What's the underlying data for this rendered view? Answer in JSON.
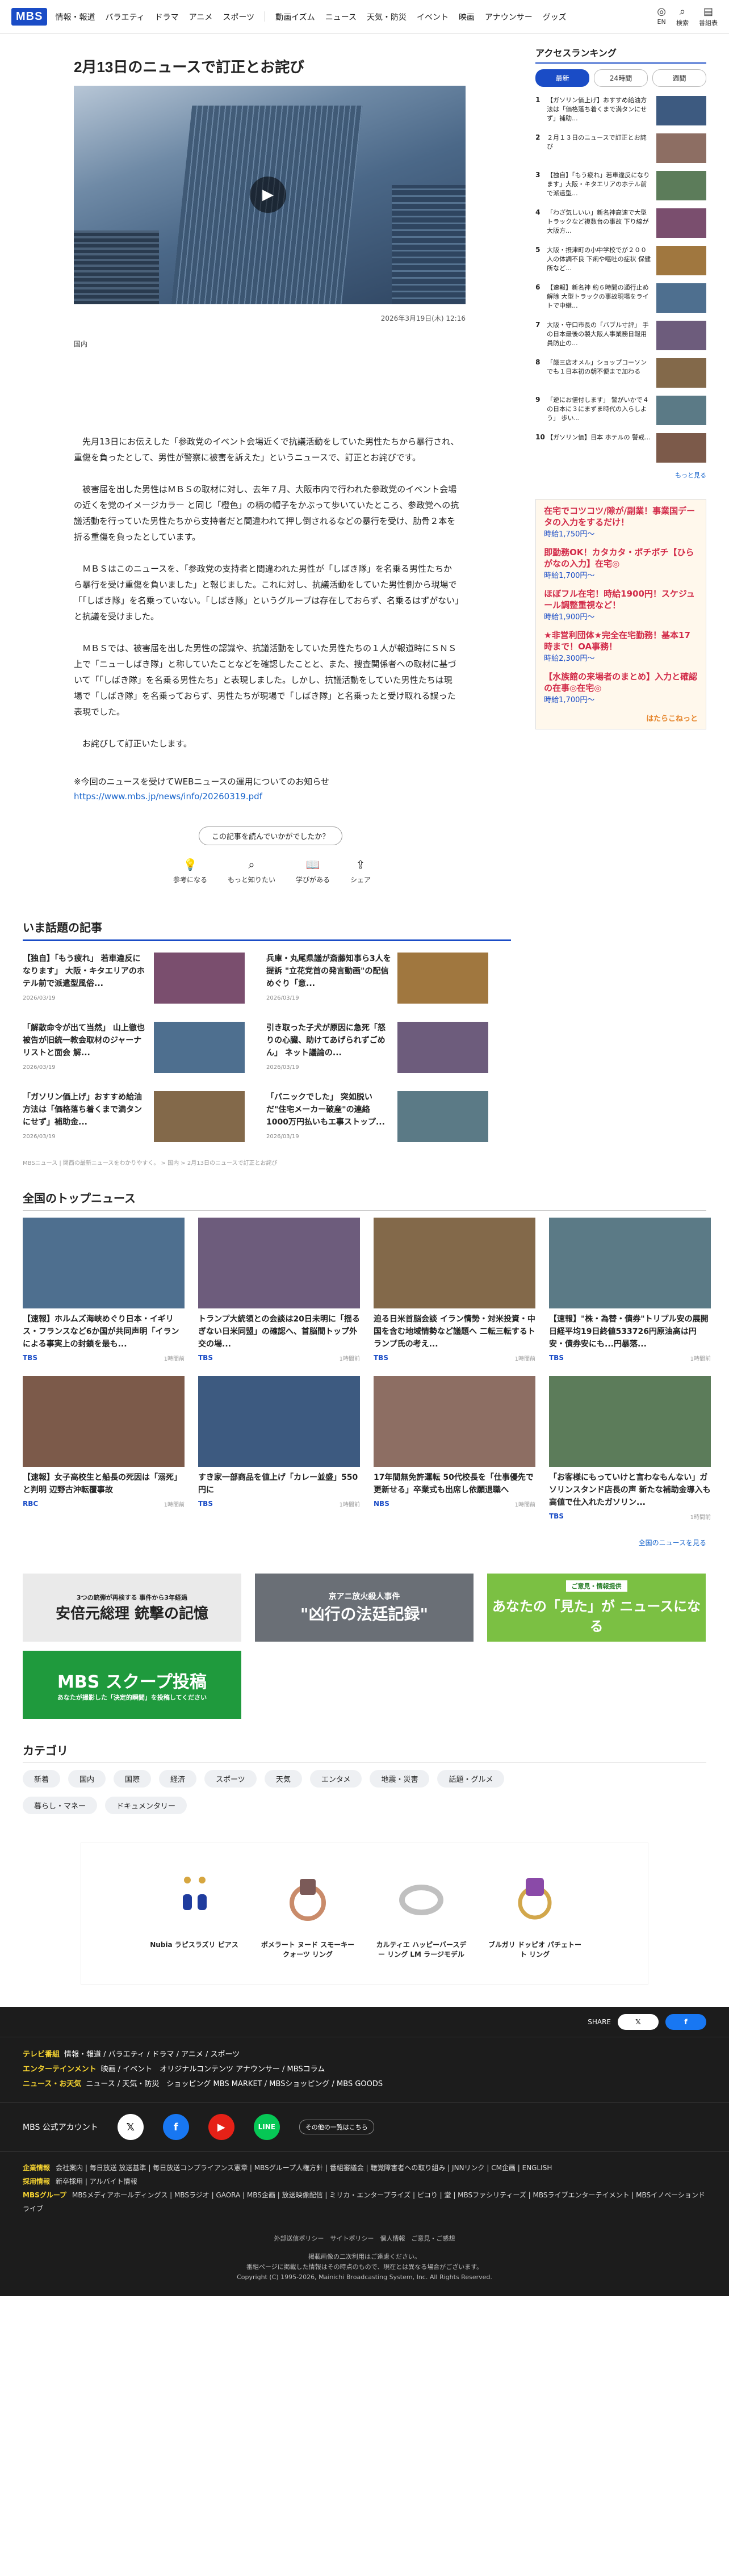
{
  "header": {
    "logo": "MBS",
    "nav": [
      "情報・報道",
      "バラエティ",
      "ドラマ",
      "アニメ",
      "スポーツ",
      "動画イズム",
      "ニュース",
      "天気・防災",
      "イベント",
      "映画",
      "アナウンサー",
      "グッズ"
    ],
    "icons": [
      {
        "label": "EN",
        "icon": "globe-icon"
      },
      {
        "label": "検索",
        "icon": "search-icon"
      },
      {
        "label": "番組表",
        "icon": "tv-guide-icon"
      }
    ]
  },
  "article": {
    "title": "2月13日のニュースで訂正とお詫び",
    "date": "2026年3月19日(木) 12:16",
    "category": "国内",
    "paragraphs": [
      "先月13日にお伝えした「参政党のイベント会場近くで抗議活動をしていた男性たちから暴行され、重傷を負ったとして、男性が警察に被害を訴えた」というニュースで、訂正とお詫びです。",
      "被害届を出した男性はＭＢＳの取材に対し、去年７月、大阪市内で行われた参政党のイベント会場の近くを党のイメージカラー と同じ「橙色」の柄の帽子をかぶって歩いていたところ、参政党への抗議活動を行っていた男性たちから支持者だと間違われて押し倒されるなどの暴行を受け、肋骨２本を折る重傷を負ったとしています。",
      "ＭＢＳはこのニュースを、「参政党の支持者と間違われた男性が「しばき隊」を名乗る男性たちから暴行を受け重傷を負いました」と報じました。これに対し、抗議活動をしていた男性側から現場で「「しばき隊」を名乗っていない。「しばき隊」というグループは存在しておらず、名乗るはずがない」と抗議を受けました。",
      "ＭＢＳでは、被害届を出した男性の認識や、抗議活動をしていた男性たちの１人が報道時にＳＮＳ上で「ニューしばき隊」と称していたことなどを確認したことと、また、捜査関係者への取材に基づいて「「しばき隊」を名乗る男性たち」と表現しました。しかし、抗議活動をしていた男性たちは現場で「しばき隊」を名乗っておらず、男性たちが現場で「しばき隊」と名乗ったと受け取れる誤った表現でした。",
      "お詫びして訂正いたします。"
    ],
    "notice": "※今回のニュースを受けてWEBニュースの運用についてのお知らせ",
    "notice_link": "https://www.mbs.jp/news/info/20260319.pdf",
    "question": "この記事を読んでいかがでしたか？",
    "reactions": [
      {
        "label": "参考になる",
        "icon": "bulb-icon"
      },
      {
        "label": "もっと知りたい",
        "icon": "search-icon"
      },
      {
        "label": "学びがある",
        "icon": "book-icon"
      },
      {
        "label": "シェア",
        "icon": "share-icon"
      }
    ]
  },
  "topics": {
    "title": "いま話題の記事",
    "items": [
      {
        "text": "【独自】「もう疲れ」 若車違反になります」 大阪・キタエリアのホテル前で派遣型風俗...",
        "date": "2026/03/19"
      },
      {
        "text": "兵庫・丸尾県議が斎藤知事ら3人を提訴 \"立花党首の発言動画\"の配信めぐり「意...",
        "date": "2026/03/19"
      },
      {
        "text": "「解散命令が出て当然」 山上徹也被告が旧統一教会取材のジャーナリストと面会 解...",
        "date": "2026/03/19"
      },
      {
        "text": "引き取った子犬が原因に急死「怒りの心臓、助けてあげられずごめん」 ネット議論の...",
        "date": "2026/03/19"
      },
      {
        "text": "「ガソリン価上げ」おすすめ給油方法は「価格落ち着くまで満タンにせず」補助金...",
        "date": "2026/03/19"
      },
      {
        "text": "「パニックでした」 突如脱いだ\"住宅メーカー破産\"の連絡 1000万円払いもエ事ストップ...",
        "date": "2026/03/19"
      }
    ],
    "note": "MBSニュース | 関西の最新ニュースをわかりやすく。 > 国内 > 2月13日のニュースで訂正とお詫び"
  },
  "top_news": {
    "title": "全国のトップニュース",
    "items": [
      {
        "text": "【速報】ホルムズ海峡めぐり日本・イギリス・フランスなど6か国が共同声明「イランによる事実上の封鎖を最も...",
        "src": "TBS",
        "when": "1時間前"
      },
      {
        "text": "トランプ大統領との会談は20日未明に「揺るぎない日米同盟」の確認へ、首脳間トップ外交の場...",
        "src": "TBS",
        "when": "1時間前"
      },
      {
        "text": "迫る日米首脳会談 イラン情勢・対米投資・中国を含む地域情勢など議題へ 二転三転するトランプ氏の考え...",
        "src": "TBS",
        "when": "1時間前"
      },
      {
        "text": "【速報】\"株・為替・債券\"トリプル安の展開 日経平均19日終値533726円原油高は円安・債券安にも...円暴落...",
        "src": "TBS",
        "when": "1時間前"
      },
      {
        "text": "【速報】女子高校生と船長の死因は「溺死」と判明 辺野古沖転覆事故",
        "src": "RBC",
        "when": "1時間前"
      },
      {
        "text": "すき家一部商品を値上げ「カレー並盛」550円に",
        "src": "TBS",
        "when": "1時間前"
      },
      {
        "text": "17年間無免許運転 50代校長を「仕事優先で更新せる」卒業式も出席し依願退職へ",
        "src": "NBS",
        "when": "1時間前"
      },
      {
        "text": "「お客様にもっていけと言わなもんない」ガソリンスタンド店長の声 新たな補助金導入も高値で仕入れたガソリン...",
        "src": "TBS",
        "when": "1時間前"
      }
    ],
    "more": "全国のニュースを見る"
  },
  "banners": [
    {
      "sub": "3つの銃弾が再検する 事件から3年経過",
      "main": "安倍元総理 銃撃の記憶"
    },
    {
      "sub": "京アニ放火殺人事件",
      "main": "\"凶行の法廷記録\""
    },
    {
      "sub": "ご意見・情報提供",
      "main": "あなたの「見た」が ニュースになる"
    },
    {
      "sub": "あなたが撮影した「決定的瞬間」を投稿してください",
      "main": "MBS スクープ投稿"
    }
  ],
  "categories": {
    "title": "カテゴリ",
    "tags": [
      "新着",
      "国内",
      "国際",
      "経済",
      "スポーツ",
      "天気",
      "エンタメ",
      "地震・災害",
      "話題・グルメ",
      "暮らし・マネー",
      "ドキュメンタリー"
    ]
  },
  "ad": {
    "brand": "Nubia ラピスラズリ ピアス",
    "items": [
      "ポメラート ヌード スモーキー クォーツ リング",
      "カルティエ ハッピーバースデー リング LM ラージモデル",
      "ブルガリ ドッピオ パチェトート リング"
    ]
  },
  "sidebar": {
    "title": "アクセスランキング",
    "tabs": [
      "最新",
      "24時間",
      "週間"
    ],
    "items": [
      "【ガソリン価上げ】おすすめ給油方法は「価格落ち着くまで満タンにせず」補助...",
      "２月１３日のニュースで訂正とお詫び",
      "【独自】「もう疲れ」若車違反になります」大阪・キタエリアのホテル前で派遣型...",
      "「わざ気しいい」新名神高速で大型トラックなど複数台の事故 下り線が大阪方...",
      "大阪・摂津町の小中学校でが２００人の体調不良 下痢や嘔吐の症状 保健所など...",
      "【速報】新名神 約６時間の通行止め解除 大型トラックの事故現場をライトで中継...",
      "大阪・守口市長の「バブル寸評」 手の日本最後の製大阪人事業務日報用員防止の...",
      "「厳三店オメル」ショップコーソンでも１日本初の朝不便まで加わる",
      "「逆にお値付します」 警がいかで４の日本に３にまずま時代の入らしよう」 歩い...",
      "【ガソリン価】日本 ホテルの 警戒..."
    ],
    "more": "もっと見る"
  },
  "side_ad": {
    "items": [
      {
        "h": "在宅でコツコツ/隙が/副業！事業国データの入力をするだけ！",
        "p": "時給1,750円〜"
      },
      {
        "h": "即勤務OK！カタカタ・ポチポチ【ひらがなの入力】在宅◎",
        "p": "時給1,700円〜"
      },
      {
        "h": "ほぼフル在宅！時給1900円！スケジュール調整重視など！",
        "p": "時給1,900円〜"
      },
      {
        "h": "★非営利団体★完全在宅勤務！基本17時まで！OA事務！",
        "p": "時給2,300円〜"
      },
      {
        "h": "【水族館の来場者のまとめ】入力と確認の在事◎在宅◎",
        "p": "時給1,700円〜"
      }
    ],
    "brand": "はたらこねっと"
  },
  "footer": {
    "share": "SHARE",
    "rows": [
      {
        "lab": "テレビ番組",
        "links": "情報・報道 / バラエティ / ドラマ / アニメ / スポーツ"
      },
      {
        "lab": "エンターテインメント",
        "links": "映画 / イベント　オリジナルコンテンツ アナウンサー / MBSコラム"
      },
      {
        "lab": "ニュース・お天気",
        "links": "ニュース / 天気・防災　ショッピング MBS MARKET / MBSショッピング / MBS GOODS"
      }
    ],
    "official": "MBS 公式アカウント",
    "official_more": "その他の一覧はこちら",
    "corp": [
      {
        "lab": "企業情報",
        "links": "会社案内 | 毎日放送 放送基準 | 毎日放送コンプライアンス憲章 | MBSグループ人権方針 | 番組審議会 | 聴覚障害者への取り組み | JNNリンク | CM企画 | ENGLISH"
      },
      {
        "lab": "採用情報",
        "links": "新卒採用 | アルバイト情報"
      },
      {
        "lab": "MBSグループ",
        "links": "MBSメディアホールディングス | MBSラジオ | GAORA | MBS企画 | 放送映像配信 | ミリカ・エンタープライズ | ピコり | 堂 | MBSファシリティーズ | MBSライブエンターテイメント | MBSイノベーションドライブ"
      }
    ],
    "bottom": [
      "外部送信ポリシー　サイトポリシー　個人情報　ご意見・ご感想",
      "掲載画像の二次利用はご遠慮ください。",
      "番組ページに掲載した情報はその時点のもので、現在とは異なる場合がございます。",
      "Copyright (C) 1995-2026, Mainichi Broadcasting System, Inc. All Rights Reserved."
    ]
  },
  "colors": {
    "brand": "#1a4cc6",
    "footer_bg": "#1c1c1c",
    "accent_yellow": "#f7d431"
  }
}
